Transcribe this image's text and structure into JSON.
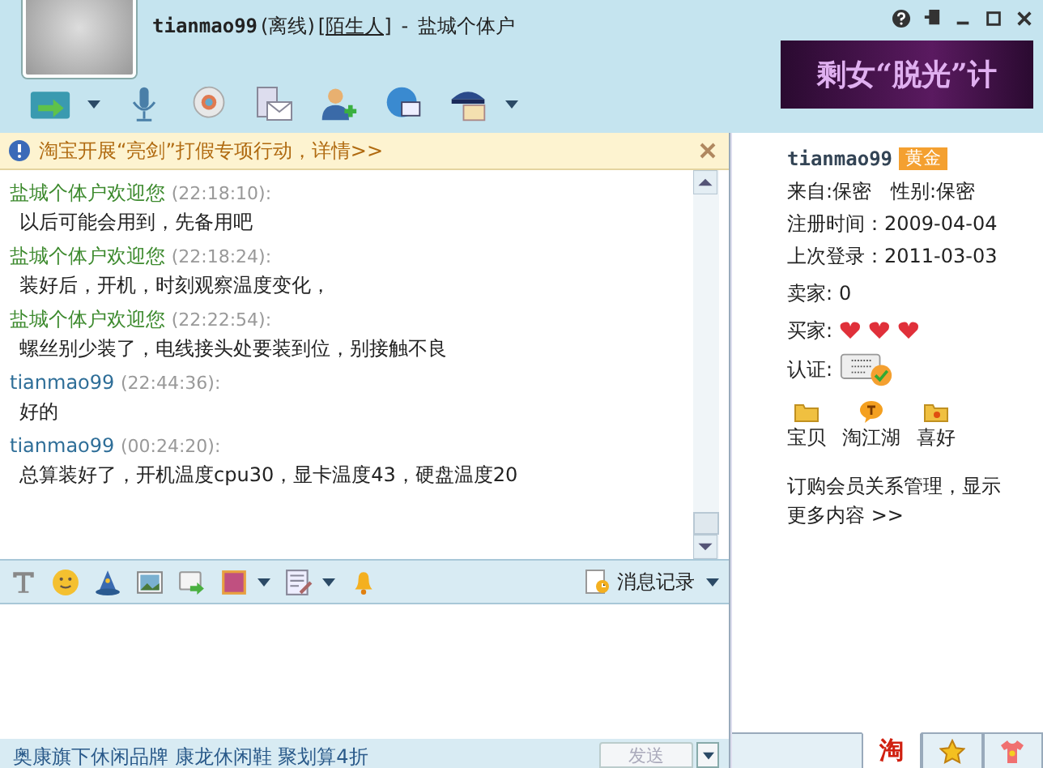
{
  "window": {
    "contact": "tianmao99",
    "status": "(离线)",
    "relation": "[陌生人]",
    "separator": "-",
    "shop": "盐城个体户"
  },
  "ad_banner": {
    "text": "剩女“脱光”计"
  },
  "notice": {
    "text": "淘宝开展“亮剑”打假专项行动，详情>>"
  },
  "messages": [
    {
      "kind": "other",
      "sender": "盐城个体户欢迎您",
      "time": "(22:18:10):",
      "text": "以后可能会用到，先备用吧"
    },
    {
      "kind": "other",
      "sender": "盐城个体户欢迎您",
      "time": "(22:18:24):",
      "text": "装好后，开机，时刻观察温度变化，"
    },
    {
      "kind": "other",
      "sender": "盐城个体户欢迎您",
      "time": "(22:22:54):",
      "text": "螺丝别少装了，电线接头处要装到位，别接触不良"
    },
    {
      "kind": "self",
      "sender": "tianmao99",
      "time": "(22:44:36):",
      "text": "好的"
    },
    {
      "kind": "self",
      "sender": "tianmao99",
      "time": "(00:24:20):",
      "text": "总算装好了，开机温度cpu30，显卡温度43，硬盘温度20"
    }
  ],
  "history_button": {
    "label": "消息记录"
  },
  "promo": {
    "text": "奥康旗下休闲品牌 康龙休闲鞋 聚划算4折"
  },
  "send_button": {
    "label": "发送",
    "disabled": true
  },
  "profile": {
    "name": "tianmao99",
    "badge": "黄金",
    "from": "来自:保密",
    "gender": "性别:保密",
    "registered": "注册时间：2009-04-04",
    "last_login": "上次登录：2011-03-03",
    "seller_label": "卖家:",
    "seller_value": "0",
    "buyer_label": "买家:",
    "cert_label": "认证:"
  },
  "profile_links": [
    {
      "kind": "folder",
      "label": "宝贝"
    },
    {
      "kind": "chat",
      "label": "淘江湖"
    },
    {
      "kind": "star-folder",
      "label": "喜好"
    }
  ],
  "manage_link": {
    "text": "订购会员关系管理，显示更多内容 >>"
  },
  "side_tabs": [
    {
      "kind": "tao",
      "label": "淘",
      "selected": true
    },
    {
      "kind": "star",
      "selected": false
    },
    {
      "kind": "shirt",
      "selected": false
    }
  ]
}
